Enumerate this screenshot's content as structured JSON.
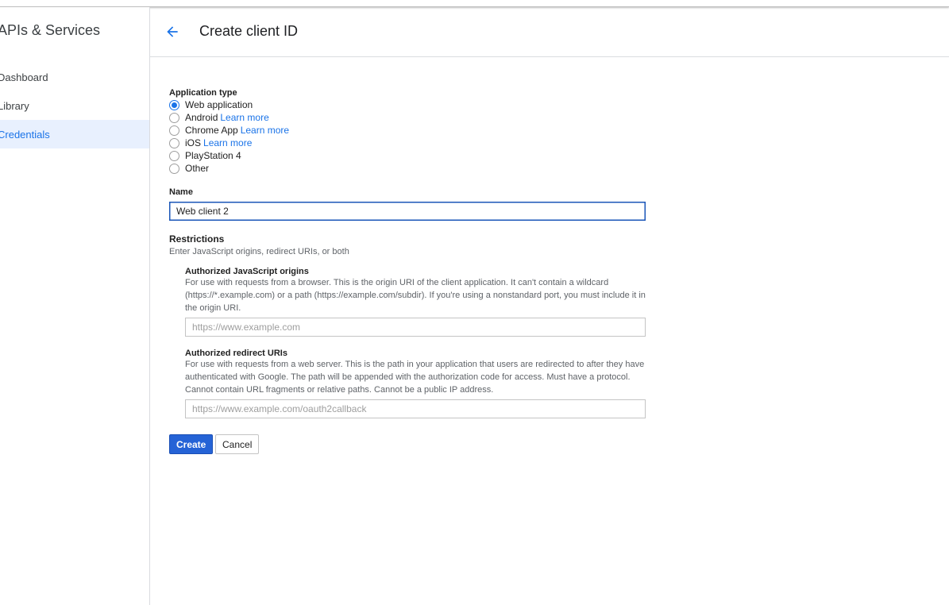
{
  "sidebar": {
    "title": "APIs & Services",
    "items": [
      {
        "label": "Dashboard",
        "active": false
      },
      {
        "label": "Library",
        "active": false
      },
      {
        "label": "Credentials",
        "active": true
      }
    ]
  },
  "header": {
    "back_icon": "arrow-left-icon",
    "title": "Create client ID"
  },
  "form": {
    "application_type": {
      "label": "Application type",
      "options": [
        {
          "label": "Web application",
          "link": "",
          "checked": true
        },
        {
          "label": "Android",
          "link": "Learn more",
          "checked": false
        },
        {
          "label": "Chrome App",
          "link": "Learn more",
          "checked": false
        },
        {
          "label": "iOS",
          "link": "Learn more",
          "checked": false
        },
        {
          "label": "PlayStation 4",
          "link": "",
          "checked": false
        },
        {
          "label": "Other",
          "link": "",
          "checked": false
        }
      ]
    },
    "name": {
      "label": "Name",
      "value": "Web client 2"
    },
    "restrictions": {
      "label": "Restrictions",
      "hint": "Enter JavaScript origins, redirect URIs, or both",
      "js_origins": {
        "label": "Authorized JavaScript origins",
        "description": "For use with requests from a browser. This is the origin URI of the client application. It can't contain a wildcard (https://*.example.com) or a path (https://example.com/subdir). If you're using a nonstandard port, you must include it in the origin URI.",
        "placeholder": "https://www.example.com"
      },
      "redirect_uris": {
        "label": "Authorized redirect URIs",
        "description": "For use with requests from a web server. This is the path in your application that users are redirected to after they have authenticated with Google. The path will be appended with the authorization code for access. Must have a protocol. Cannot contain URL fragments or relative paths. Cannot be a public IP address.",
        "placeholder": "https://www.example.com/oauth2callback"
      }
    },
    "buttons": {
      "create": "Create",
      "cancel": "Cancel"
    }
  },
  "colors": {
    "accent": "#1a73e8",
    "primary_button": "#2563d6",
    "active_nav_bg": "#e8f0fe"
  }
}
